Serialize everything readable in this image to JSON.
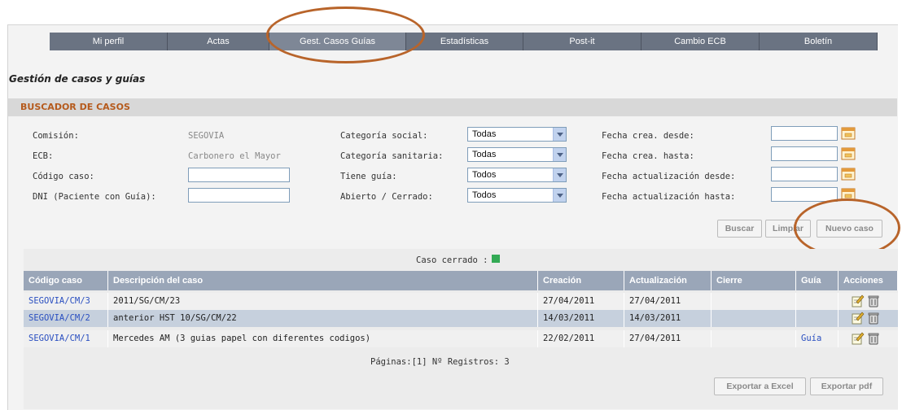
{
  "nav": {
    "items": [
      {
        "label": "Mi perfil"
      },
      {
        "label": "Actas"
      },
      {
        "label": "Gest. Casos Guías"
      },
      {
        "label": "Estadísticas"
      },
      {
        "label": "Post-it"
      },
      {
        "label": "Cambio ECB"
      },
      {
        "label": "Boletín"
      }
    ],
    "active": "Gest. Casos Guías"
  },
  "page_title": "Gestión de casos y guías",
  "search": {
    "header": "BUSCADOR DE CASOS",
    "comision_label": "Comisión:",
    "comision_value": "SEGOVIA",
    "ecb_label": "ECB:",
    "ecb_value": "Carbonero el Mayor",
    "codigo_label": "Código caso:",
    "codigo_value": "",
    "dni_label": "DNI (Paciente con Guía):",
    "dni_value": "",
    "cat_social_label": "Categoría social:",
    "cat_social_value": "Todas",
    "cat_sanitaria_label": "Categoría sanitaria:",
    "cat_sanitaria_value": "Todas",
    "tiene_guia_label": "Tiene guía:",
    "tiene_guia_value": "Todos",
    "abierto_label": "Abierto / Cerrado:",
    "abierto_value": "Todos",
    "fecha_crea_desde_label": "Fecha crea. desde:",
    "fecha_crea_hasta_label": "Fecha crea. hasta:",
    "fecha_act_desde_label": "Fecha actualización desde:",
    "fecha_act_hasta_label": "Fecha actualización hasta:",
    "buttons": {
      "buscar": "Buscar",
      "limpiar": "Limpiar",
      "nuevo": "Nuevo caso"
    }
  },
  "results": {
    "legend": "Caso cerrado :",
    "closed_color": "#33aa55",
    "columns": [
      "Código caso",
      "Descripción del caso",
      "Creación",
      "Actualización",
      "Cierre",
      "Guía",
      "Acciones"
    ],
    "rows": [
      {
        "codigo": "SEGOVIA/CM/3",
        "descripcion": "2011/SG/CM/23",
        "creacion": "27/04/2011",
        "actualizacion": "27/04/2011",
        "cierre": "",
        "guia": ""
      },
      {
        "codigo": "SEGOVIA/CM/2",
        "descripcion": "anterior HST 10/SG/CM/22",
        "creacion": "14/03/2011",
        "actualizacion": "14/03/2011",
        "cierre": "",
        "guia": ""
      },
      {
        "codigo": "SEGOVIA/CM/1",
        "descripcion": "Mercedes AM (3 guias papel con diferentes codigos)",
        "creacion": "22/02/2011",
        "actualizacion": "27/04/2011",
        "cierre": "",
        "guia": "Guía"
      }
    ],
    "pagination": "Páginas:[1]  Nº Registros: 3",
    "export_excel": "Exportar a Excel",
    "export_pdf": "Exportar pdf"
  },
  "colors": {
    "accent": "#b55a1c",
    "nav_bg": "#6a7382",
    "header_bg": "#9aa6b8",
    "highlight_ellipse": "#b8642a"
  }
}
